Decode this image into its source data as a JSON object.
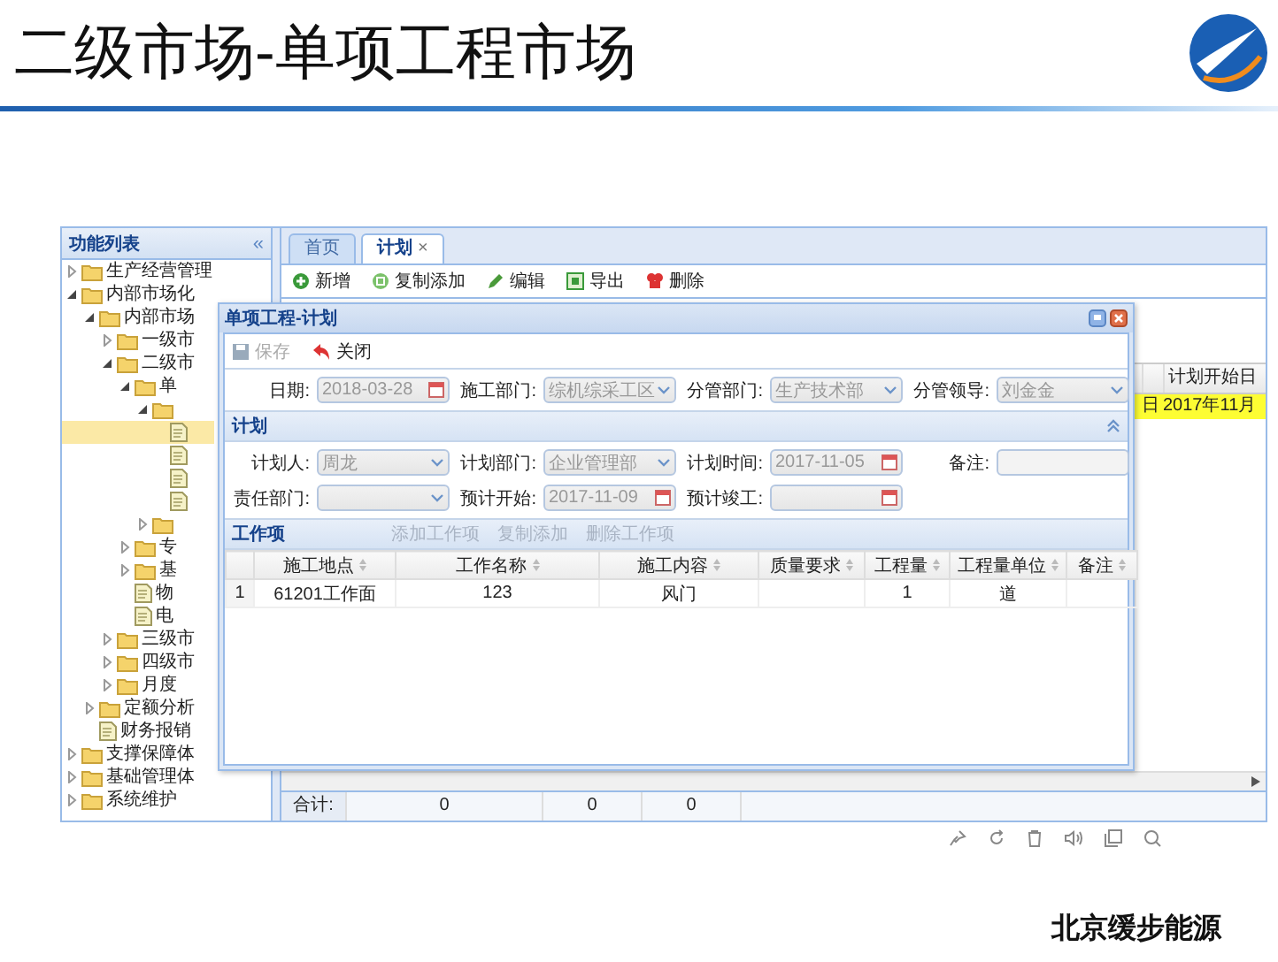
{
  "slide": {
    "title": "二级市场-单项工程市场",
    "footer": "北京缓步能源"
  },
  "sidebar": {
    "title": "功能列表",
    "collapse_glyph": "«",
    "items": [
      {
        "label": "生产经营管理",
        "kind": "folder",
        "expanded": false,
        "selected": false
      },
      {
        "label": "内部市场化",
        "kind": "folder",
        "expanded": true,
        "selected": false,
        "children": [
          {
            "label": "内部市场",
            "kind": "folder",
            "expanded": true,
            "selected": false,
            "children": [
              {
                "label": "一级市",
                "kind": "folder",
                "expanded": false,
                "selected": false
              },
              {
                "label": "二级市",
                "kind": "folder",
                "expanded": true,
                "selected": false,
                "children": [
                  {
                    "label": "单",
                    "kind": "folder",
                    "expanded": true,
                    "selected": false,
                    "children": [
                      {
                        "kind": "folder",
                        "expanded": true,
                        "selected": false,
                        "children": [
                          {
                            "kind": "file",
                            "selected": true
                          },
                          {
                            "kind": "file",
                            "selected": false
                          },
                          {
                            "kind": "file",
                            "selected": false
                          },
                          {
                            "kind": "file",
                            "selected": false
                          }
                        ]
                      },
                      {
                        "kind": "folder",
                        "expanded": false,
                        "selected": false
                      }
                    ]
                  },
                  {
                    "label": "专",
                    "kind": "folder",
                    "expanded": false,
                    "selected": false
                  },
                  {
                    "label": "基",
                    "kind": "folder",
                    "expanded": false,
                    "selected": false
                  },
                  {
                    "label": "物",
                    "kind": "file",
                    "selected": false
                  },
                  {
                    "label": "电",
                    "kind": "file",
                    "selected": false
                  }
                ]
              },
              {
                "label": "三级市",
                "kind": "folder",
                "expanded": false,
                "selected": false
              },
              {
                "label": "四级市",
                "kind": "folder",
                "expanded": false,
                "selected": false
              },
              {
                "label": "月度",
                "kind": "folder",
                "expanded": false,
                "selected": false
              }
            ]
          },
          {
            "label": "定额分析",
            "kind": "folder",
            "expanded": false,
            "selected": false
          },
          {
            "label": "财务报销",
            "kind": "file",
            "selected": false
          }
        ]
      },
      {
        "label": "支撑保障体",
        "kind": "folder",
        "expanded": false,
        "selected": false
      },
      {
        "label": "基础管理体",
        "kind": "folder",
        "expanded": false,
        "selected": false
      },
      {
        "label": "系统维护",
        "kind": "folder",
        "expanded": false,
        "selected": false
      }
    ]
  },
  "tabs": [
    {
      "label": "首页",
      "selected": false
    },
    {
      "label": "计划",
      "selected": true,
      "close": "×"
    }
  ],
  "toolbar": [
    {
      "label": "新增",
      "kind": "add"
    },
    {
      "label": "复制添加",
      "kind": "copy"
    },
    {
      "label": "编辑",
      "kind": "edit"
    },
    {
      "label": "导出",
      "kind": "export"
    },
    {
      "label": "删除",
      "kind": "delete"
    }
  ],
  "grid": {
    "columns": [
      "",
      "计划开始日"
    ],
    "rows": [
      {
        "cells": [
          "日",
          "2017年11月"
        ],
        "selected": true
      }
    ],
    "footer": {
      "label": "合计:",
      "values": [
        "0",
        "0",
        "0"
      ]
    }
  },
  "dialog": {
    "title": "单项工程-计划",
    "toolbar": [
      {
        "label": "保存",
        "kind": "save",
        "disabled": true
      },
      {
        "label": "关闭",
        "kind": "undo",
        "disabled": false
      }
    ],
    "fields": [
      {
        "label": "日期:",
        "kind": "date",
        "value": "2018-03-28"
      },
      {
        "label": "施工部门:",
        "kind": "select",
        "value": "综机综采工区"
      },
      {
        "label": "分管部门:",
        "kind": "select",
        "value": "生产技术部"
      },
      {
        "label": "分管领导:",
        "kind": "select",
        "value": "刘金金"
      }
    ],
    "plan": {
      "title": "计划",
      "expanded": true,
      "fields": [
        {
          "label": "计划人:",
          "kind": "select",
          "value": "周龙"
        },
        {
          "label": "计划部门:",
          "kind": "select",
          "value": "企业管理部"
        },
        {
          "label": "计划时间:",
          "kind": "date",
          "value": "2017-11-05"
        },
        {
          "label": "备注:",
          "kind": "text"
        },
        {
          "label": "责任部门:",
          "kind": "select"
        },
        {
          "label": "预计开始:",
          "kind": "date",
          "value": "2017-11-09"
        },
        {
          "label": "预计竣工:",
          "kind": "date"
        }
      ]
    },
    "work_items": {
      "title": "工作项",
      "actions": [
        {
          "label": "添加工作项",
          "disabled": true
        },
        {
          "label": "复制添加",
          "disabled": true
        },
        {
          "label": "删除工作项",
          "disabled": true
        }
      ],
      "columns": [
        "施工地点",
        "工作名称",
        "施工内容",
        "质量要求",
        "工程量",
        "工程量单位",
        "备注"
      ],
      "rows": [
        {
          "number": "1",
          "cells": [
            "61201工作面",
            "123",
            "风门",
            null,
            "1",
            "道",
            null
          ]
        }
      ]
    }
  }
}
